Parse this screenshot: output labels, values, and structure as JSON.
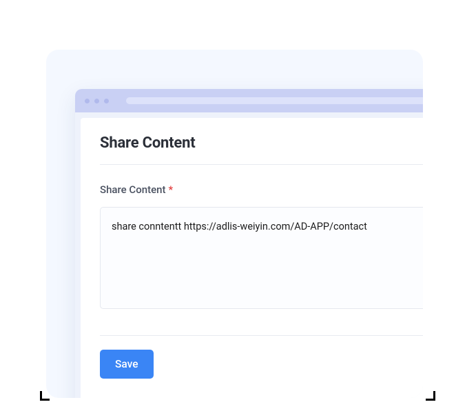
{
  "page": {
    "title": "Share Content"
  },
  "form": {
    "share_content": {
      "label": "Share Content",
      "required_marker": "*",
      "value": "share conntentt https://adlis-weiyin.com/AD-APP/contact"
    }
  },
  "actions": {
    "save_label": "Save"
  }
}
